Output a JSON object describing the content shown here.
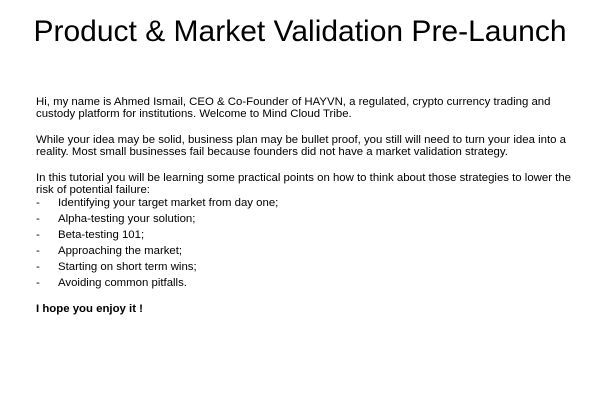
{
  "title": "Product & Market Validation Pre-Launch",
  "paragraphs": [
    "Hi, my name is Ahmed Ismail, CEO & Co-Founder of HAYVN, a regulated, crypto currency trading and custody platform for institutions. Welcome to Mind Cloud Tribe.",
    "While your idea may be solid, business plan may be bullet proof, you still will need to turn your idea into a reality. Most small businesses fail because founders did not have a market validation strategy."
  ],
  "tutorial_intro": "In this tutorial you will be learning some practical points on how to think about those strategies to lower the risk of potential failure:",
  "bullet_marker": "-",
  "bullets": [
    "Identifying your target market from day one;",
    "Alpha-testing your solution;",
    "Beta-testing 101;",
    "Approaching the market;",
    "Starting on short term wins;",
    "Avoiding common pitfalls."
  ],
  "closing": "I hope you enjoy it !"
}
